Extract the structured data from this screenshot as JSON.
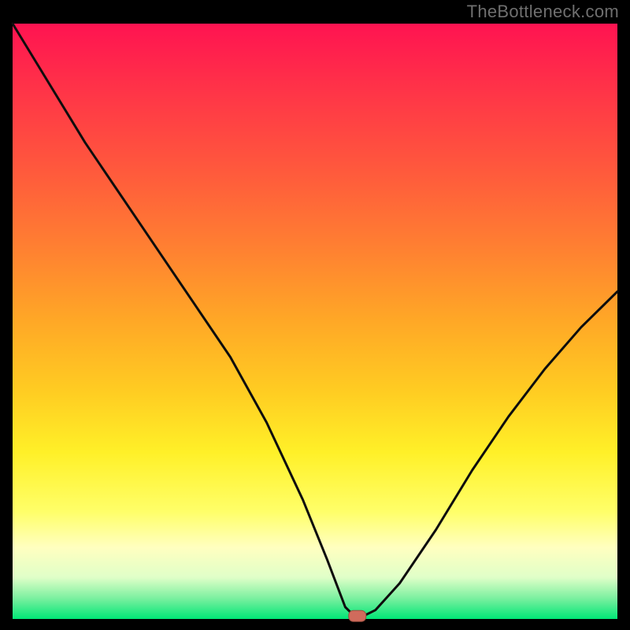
{
  "watermark": "TheBottleneck.com",
  "chart_data": {
    "type": "line",
    "title": "",
    "xlabel": "",
    "ylabel": "",
    "xlim": [
      0,
      100
    ],
    "ylim": [
      0,
      100
    ],
    "x": [
      0,
      6,
      12,
      18,
      24,
      30,
      36,
      42,
      48,
      52,
      55,
      56.5,
      58,
      60,
      64,
      70,
      76,
      82,
      88,
      94,
      100
    ],
    "values": [
      100,
      90,
      80,
      71,
      62,
      53,
      44,
      33,
      20,
      10,
      2,
      0.5,
      0.5,
      1.5,
      6,
      15,
      25,
      34,
      42,
      49,
      55
    ],
    "marker": {
      "x": 57,
      "y": 0.5
    }
  },
  "colors": {
    "black": "#000000",
    "curve": "#0d0d0d",
    "marker_fill": "#d06b5c",
    "marker_stroke": "#994e3f",
    "gradient_stops": [
      {
        "offset": 0.0,
        "color": "#ff1351"
      },
      {
        "offset": 0.12,
        "color": "#ff3647"
      },
      {
        "offset": 0.25,
        "color": "#ff5a3c"
      },
      {
        "offset": 0.38,
        "color": "#ff8131"
      },
      {
        "offset": 0.5,
        "color": "#ffa826"
      },
      {
        "offset": 0.62,
        "color": "#ffcd22"
      },
      {
        "offset": 0.72,
        "color": "#fff028"
      },
      {
        "offset": 0.82,
        "color": "#ffff69"
      },
      {
        "offset": 0.88,
        "color": "#ffffc0"
      },
      {
        "offset": 0.93,
        "color": "#e0ffc8"
      },
      {
        "offset": 0.965,
        "color": "#7cf0a0"
      },
      {
        "offset": 1.0,
        "color": "#00e676"
      }
    ]
  },
  "layout": {
    "total": 800,
    "margin_left": 16,
    "margin_right": 16,
    "margin_top": 30,
    "margin_bottom": 14
  }
}
